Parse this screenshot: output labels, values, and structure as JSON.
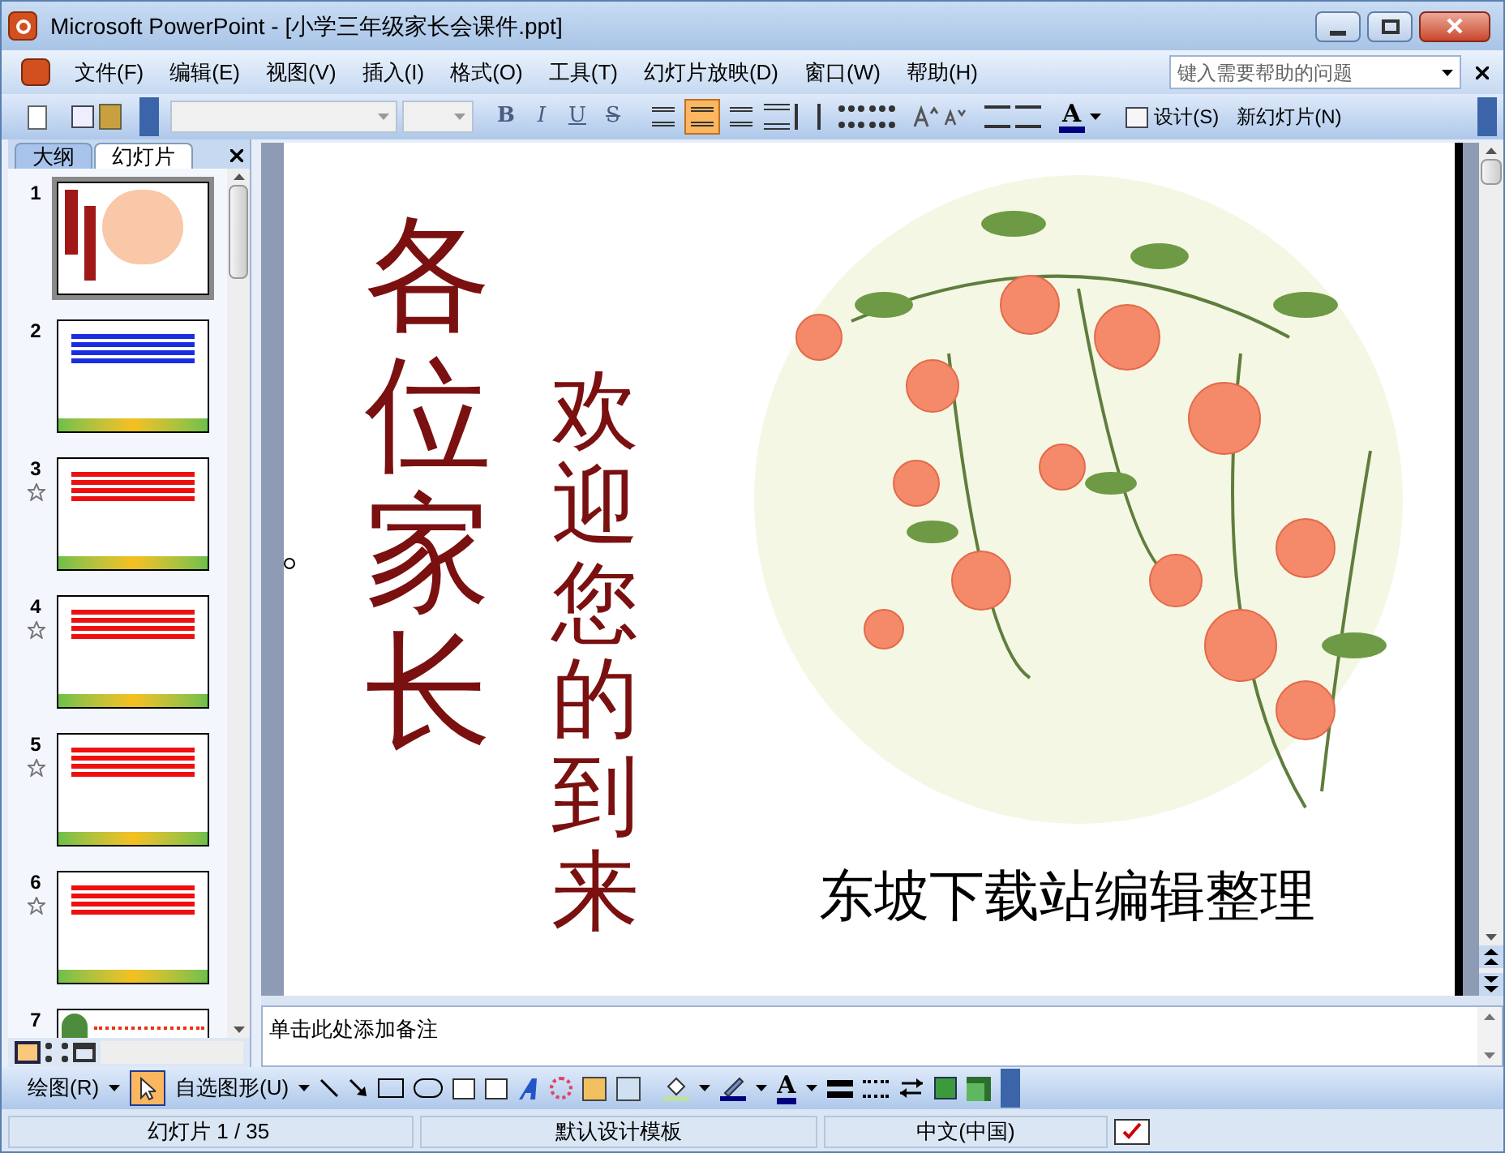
{
  "window": {
    "title": "Microsoft PowerPoint - [小学三年级家长会课件.ppt]"
  },
  "menu": [
    "文件(F)",
    "编辑(E)",
    "视图(V)",
    "插入(I)",
    "格式(O)",
    "工具(T)",
    "幻灯片放映(D)",
    "窗口(W)",
    "帮助(H)"
  ],
  "help_search": {
    "placeholder": "键入需要帮助的问题"
  },
  "formatting": {
    "text_styles": [
      "B",
      "I",
      "U",
      "S"
    ],
    "align_buttons": [
      {
        "selected": false
      },
      {
        "selected": true
      },
      {
        "selected": false
      }
    ],
    "font_color_label": "A",
    "design_button": "设计(S)",
    "new_slide_button": "新幻灯片(N)"
  },
  "panel_tabs": [
    {
      "label": "大纲",
      "selected": false
    },
    {
      "label": "幻灯片",
      "selected": true
    }
  ],
  "slides": [
    {
      "number": "1",
      "selected": true,
      "animated": false,
      "kind": "title"
    },
    {
      "number": "2",
      "selected": false,
      "animated": false,
      "kind": "blue"
    },
    {
      "number": "3",
      "selected": false,
      "animated": true,
      "kind": "red"
    },
    {
      "number": "4",
      "selected": false,
      "animated": true,
      "kind": "red"
    },
    {
      "number": "5",
      "selected": false,
      "animated": true,
      "kind": "red"
    },
    {
      "number": "6",
      "selected": false,
      "animated": true,
      "kind": "red"
    },
    {
      "number": "7",
      "selected": false,
      "animated": false,
      "kind": "leaf"
    }
  ],
  "slide": {
    "title": "各位家长",
    "subtitle": "欢迎您的到来",
    "credit": "东坡下载站编辑整理"
  },
  "notes": {
    "placeholder": "单击此处添加备注"
  },
  "drawing_toolbar": {
    "draw_menu": "绘图(R)",
    "pointer_selected": true,
    "autoshapes": "自选图形(U)",
    "font_color_label": "A"
  },
  "status_bar": [
    "幻灯片 1 / 35",
    "默认设计模板",
    "中文(中国)"
  ]
}
